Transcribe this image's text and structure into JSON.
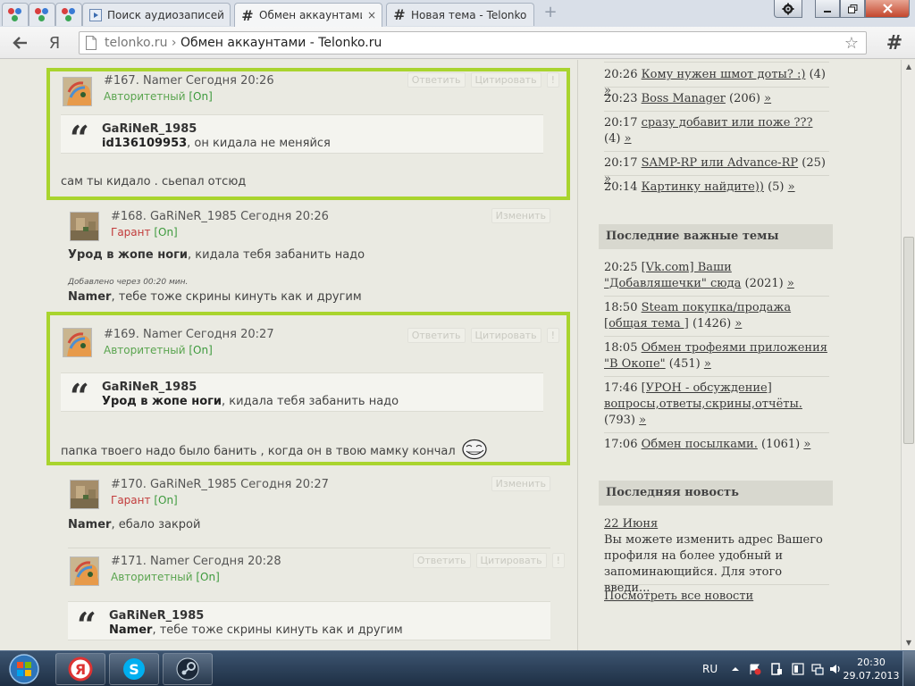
{
  "browser": {
    "tabs": [
      {
        "title": "Поиск аудиозаписей"
      },
      {
        "title": "Обмен аккаунтами -"
      },
      {
        "title": "Новая тема - Telonko"
      }
    ],
    "new_tab": "+",
    "close": "×",
    "address": {
      "domain": "telonko.ru",
      "sep": "›",
      "title": "Обмен аккаунтами - Telonko.ru"
    },
    "yandex_letter": "Я",
    "hash": "#"
  },
  "posts": [
    {
      "num": "#167.",
      "author": "Namer",
      "time": "Сегодня 20:26",
      "rank": "Авторитетный",
      "status": "[On]",
      "actions": [
        "Ответить",
        "Цитировать",
        "!"
      ],
      "quote": {
        "author": "GaRiNeR_1985",
        "bold": "id136109953",
        "text": ", он кидала не меняйся"
      },
      "text": "сам ты кидало . сьепал отсюд"
    },
    {
      "num": "#168.",
      "author": "GaRiNeR_1985",
      "time": "Сегодня 20:26",
      "rank": "Гарант",
      "status": "[On]",
      "actions": [
        "Изменить"
      ],
      "text_bold": "Урод в жопе ноги",
      "text": ", кидала тебя забанить надо",
      "added": "Добавлено через 00:20 мин.",
      "text2_bold": "Namer",
      "text2": ", тебе тоже скрины кинуть как и другим"
    },
    {
      "num": "#169.",
      "author": "Namer",
      "time": "Сегодня 20:27",
      "rank": "Авторитетный",
      "status": "[On]",
      "actions": [
        "Ответить",
        "Цитировать",
        "!"
      ],
      "quote": {
        "author": "GaRiNeR_1985",
        "bold": "Урод в жопе ноги",
        "text": ", кидала тебя забанить надо"
      },
      "text": "папка твоего надо было банить , когда он в твою мамку кончал"
    },
    {
      "num": "#170.",
      "author": "GaRiNeR_1985",
      "time": "Сегодня 20:27",
      "rank": "Гарант",
      "status": "[On]",
      "actions": [
        "Изменить"
      ],
      "text_bold": "Namer",
      "text": ", ебало закрой"
    },
    {
      "num": "#171.",
      "author": "Namer",
      "time": "Сегодня 20:28",
      "rank": "Авторитетный",
      "status": "[On]",
      "actions": [
        "Ответить",
        "Цитировать",
        "!"
      ],
      "quote": {
        "author": "GaRiNeR_1985",
        "bold": "Namer",
        "text": ", тебе тоже скрины кинуть как и другим"
      }
    }
  ],
  "sidebar": {
    "recent": [
      {
        "time": "20:26",
        "title": "Кому нужен шмот доты? :)",
        "count": "(4)",
        "arrow": "»"
      },
      {
        "time": "20:23",
        "title": "Boss Manager",
        "count": "(206)",
        "arrow": "»"
      },
      {
        "time": "20:17",
        "title": "сразу добавит или поже ???",
        "count": "(4)",
        "arrow": "»"
      },
      {
        "time": "20:17",
        "title": "SAMP-RP или Advance-RP",
        "count": "(25)",
        "arrow": "»"
      },
      {
        "time": "20:14",
        "title": "Картинку найдите))",
        "count": "(5)",
        "arrow": "»"
      }
    ],
    "important_title": "Последние важные темы",
    "important": [
      {
        "time": "20:25",
        "title": "[Vk.com] Ваши \"Добавляшечки\" сюда",
        "count": "(2021)",
        "arrow": "»"
      },
      {
        "time": "18:50",
        "title": "Steam покупка/продажа [общая тема ]",
        "count": "(1426)",
        "arrow": "»"
      },
      {
        "time": "18:05",
        "title": "Обмен трофеями приложения \"В Окопе\"",
        "count": "(451)",
        "arrow": "»"
      },
      {
        "time": "17:46",
        "title": "[УРОН - обсуждение] вопросы,ответы,скрины,отчёты.",
        "count": "(793)",
        "arrow": "»"
      },
      {
        "time": "17:06",
        "title": "Обмен посылками.",
        "count": "(1061)",
        "arrow": "»"
      }
    ],
    "news_title": "Последняя новость",
    "news_date": "22 Июня",
    "news_text": "Вы можете изменить адрес Вашего профиля на более удобный и запоминающийся. Для этого введи...",
    "news_all": "Посмотреть все новости"
  },
  "taskbar": {
    "lang": "RU",
    "time": "20:30",
    "date": "29.07.2013"
  },
  "colors": {
    "highlight": "#a9d42e",
    "rank_green": "#59a44e",
    "rank_red": "#c23b3b",
    "on": "#3d9a3d"
  }
}
